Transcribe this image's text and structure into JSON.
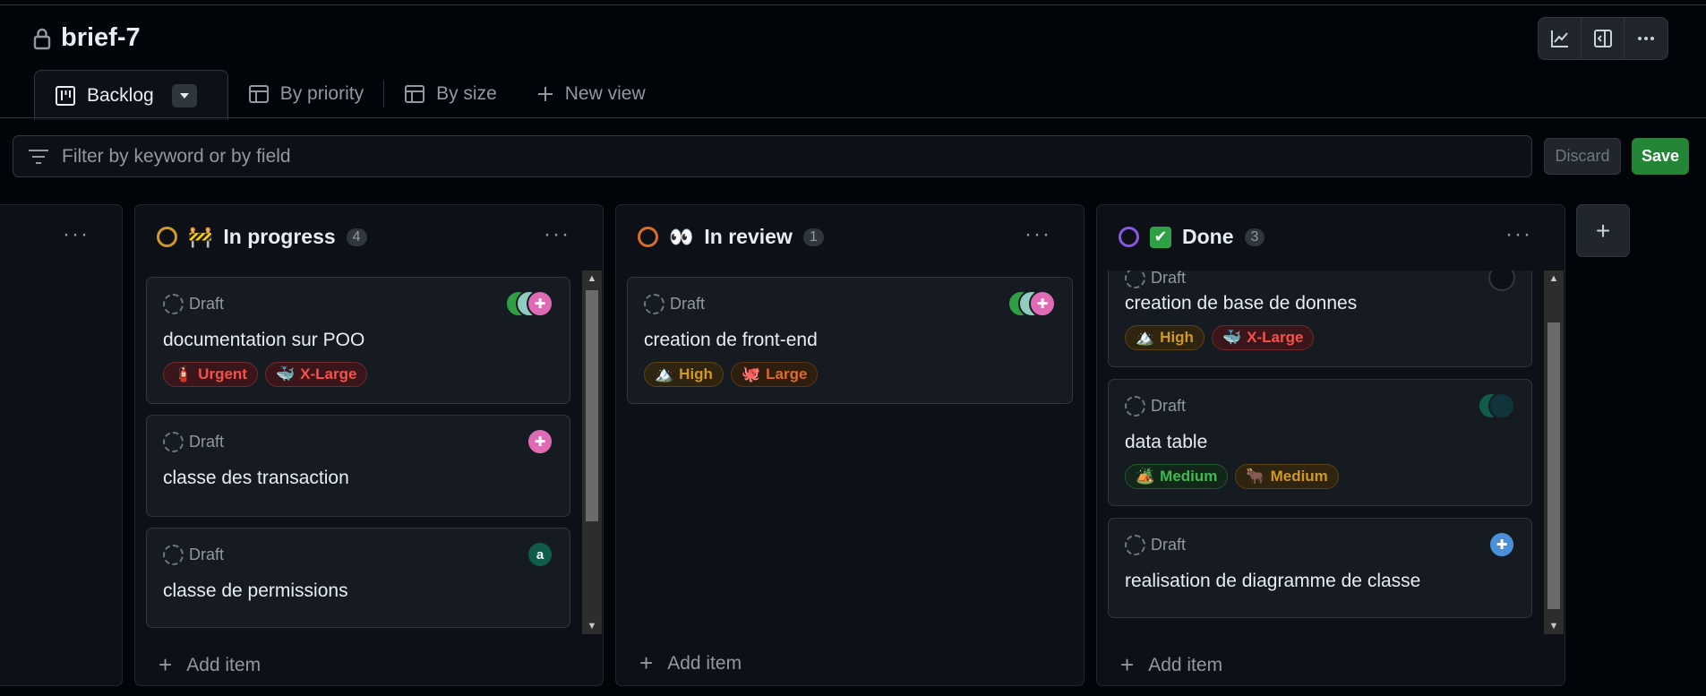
{
  "project": {
    "title": "brief-7"
  },
  "tabs": [
    {
      "label": "Backlog"
    },
    {
      "label": "By priority"
    },
    {
      "label": "By size"
    },
    {
      "label": "New view"
    }
  ],
  "filter": {
    "placeholder": "Filter by keyword or by field",
    "discard_label": "Discard",
    "save_label": "Save"
  },
  "add_item_label": "Add item",
  "columns": {
    "in_progress": {
      "name": "In progress",
      "count": "4",
      "status_color": "#d29922",
      "cards": [
        {
          "status": "Draft",
          "title": "documentation sur POO",
          "labels": [
            {
              "text": "Urgent",
              "icon": "fire-extinguisher"
            },
            {
              "text": "X-Large",
              "icon": "whale"
            }
          ]
        },
        {
          "status": "Draft",
          "title": "classe des transaction"
        },
        {
          "status": "Draft",
          "title": "classe de permissions",
          "avatar_initial": "a"
        }
      ]
    },
    "in_review": {
      "name": "In review",
      "count": "1",
      "status_color": "#db6d28",
      "cards": [
        {
          "status": "Draft",
          "title": "creation de front-end",
          "labels": [
            {
              "text": "High",
              "icon": "mountain"
            },
            {
              "text": "Large",
              "icon": "octopus"
            }
          ]
        }
      ]
    },
    "done": {
      "name": "Done",
      "count": "3",
      "status_color": "#8957e5",
      "cards": [
        {
          "status": "Draft",
          "title": "creation de base de donnes",
          "labels": [
            {
              "text": "High",
              "icon": "mountain"
            },
            {
              "text": "X-Large",
              "icon": "whale"
            }
          ]
        },
        {
          "status": "Draft",
          "title": "data table",
          "labels": [
            {
              "text": "Medium",
              "icon": "camping"
            },
            {
              "text": "Medium",
              "icon": "ox"
            }
          ]
        },
        {
          "status": "Draft",
          "title": "realisation de diagramme de classe"
        }
      ]
    }
  },
  "colors": {
    "urgent": "#f85149",
    "high": "#d29922",
    "medium_green": "#3fb950",
    "xlarge": "#f85149",
    "large": "#db6d28",
    "medium_size": "#d29922"
  }
}
